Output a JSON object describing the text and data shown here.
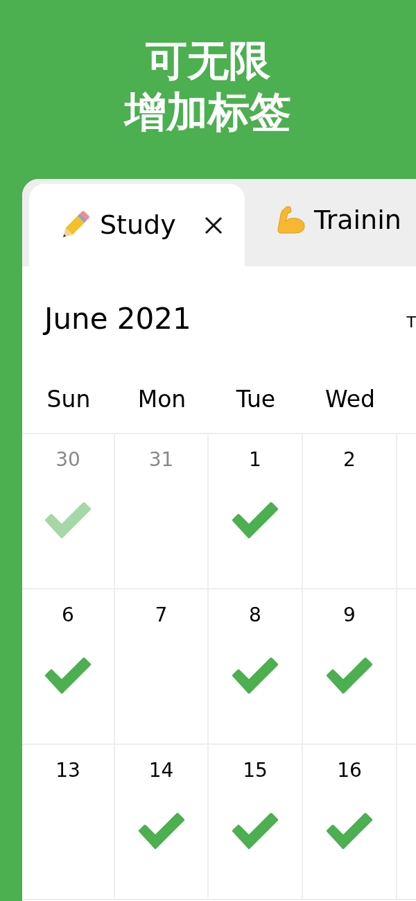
{
  "headline": [
    "可无限",
    "增加标签"
  ],
  "tabs": [
    {
      "label": "Study",
      "selected": true
    },
    {
      "label": "Trainin",
      "selected": false
    }
  ],
  "calendar": {
    "month": "June 2021",
    "today_button": "T",
    "weekdays": [
      "Sun",
      "Mon",
      "Tue",
      "Wed"
    ],
    "weeks": [
      [
        {
          "day": "30",
          "muted": true,
          "checked": true
        },
        {
          "day": "31",
          "muted": true,
          "checked": false
        },
        {
          "day": "1",
          "muted": false,
          "checked": true
        },
        {
          "day": "2",
          "muted": false,
          "checked": false
        }
      ],
      [
        {
          "day": "6",
          "muted": false,
          "checked": true
        },
        {
          "day": "7",
          "muted": false,
          "checked": false
        },
        {
          "day": "8",
          "muted": false,
          "checked": true
        },
        {
          "day": "9",
          "muted": false,
          "checked": true
        }
      ],
      [
        {
          "day": "13",
          "muted": false,
          "checked": false
        },
        {
          "day": "14",
          "muted": false,
          "checked": true
        },
        {
          "day": "15",
          "muted": false,
          "checked": true
        },
        {
          "day": "16",
          "muted": false,
          "checked": true
        }
      ]
    ]
  }
}
